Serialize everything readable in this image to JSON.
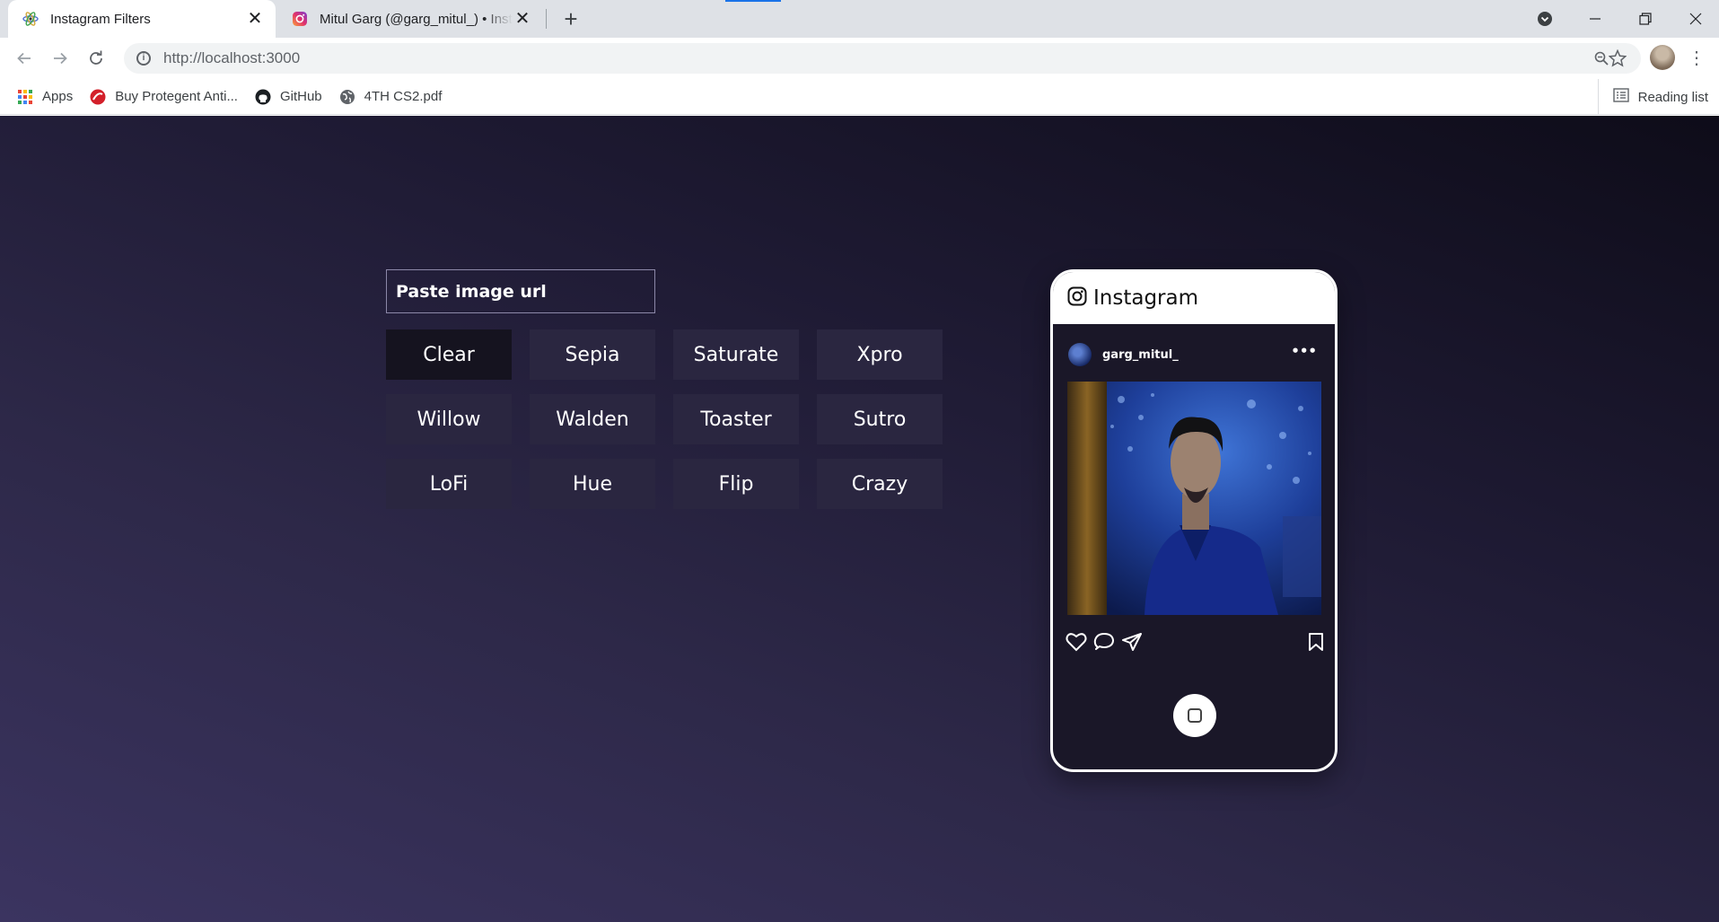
{
  "browser": {
    "tabs": [
      {
        "title": "Instagram Filters",
        "favicon": "react-icon",
        "active": true
      },
      {
        "title": "Mitul Garg (@garg_mitul_) • Instagram",
        "favicon": "instagram-icon",
        "active": false
      }
    ],
    "new_tab_label": "+",
    "close_label": "✕",
    "url": "http://localhost:3000",
    "bookmarks": [
      {
        "label": "Apps",
        "icon": "apps-grid-icon"
      },
      {
        "label": "Buy Protegent Anti...",
        "icon": "protegent-icon"
      },
      {
        "label": "GitHub",
        "icon": "github-icon"
      },
      {
        "label": "4TH CS2.pdf",
        "icon": "globe-icon"
      }
    ],
    "reading_list": "Reading list"
  },
  "page": {
    "input_placeholder": "Paste image url",
    "filters": [
      {
        "label": "Clear",
        "active": true
      },
      {
        "label": "Sepia",
        "active": false
      },
      {
        "label": "Saturate",
        "active": false
      },
      {
        "label": "Xpro",
        "active": false
      },
      {
        "label": "Willow",
        "active": false
      },
      {
        "label": "Walden",
        "active": false
      },
      {
        "label": "Toaster",
        "active": false
      },
      {
        "label": "Sutro",
        "active": false
      },
      {
        "label": "LoFi",
        "active": false
      },
      {
        "label": "Hue",
        "active": false
      },
      {
        "label": "Flip",
        "active": false
      },
      {
        "label": "Crazy",
        "active": false
      }
    ],
    "active_color": "#15131f",
    "button_color": "#2a2640"
  },
  "phone": {
    "brand": "Instagram",
    "username": "garg_mitul_",
    "more": "•••"
  }
}
